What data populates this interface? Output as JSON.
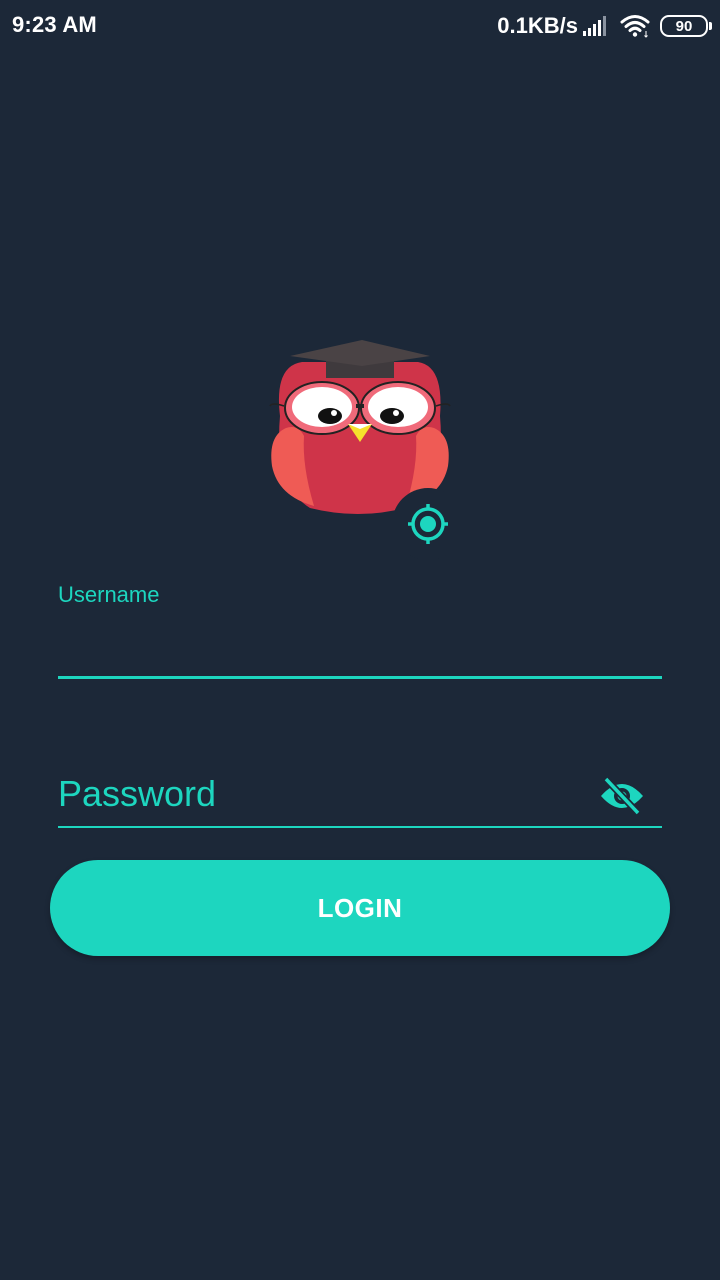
{
  "status_bar": {
    "time": "9:23 AM",
    "network_speed": "0.1KB/s",
    "battery_level": "90",
    "icons": [
      "signal-icon",
      "wifi-icon",
      "battery-icon"
    ]
  },
  "logo": {
    "icon": "owl-graduate-logo",
    "locate_icon": "crosshair-target-icon"
  },
  "form": {
    "username": {
      "label": "Username",
      "value": ""
    },
    "password": {
      "placeholder": "Password",
      "value": "",
      "toggle_icon": "eye-off-icon"
    },
    "login_label": "LOGIN"
  },
  "colors": {
    "background": "#1c2838",
    "accent": "#1dd6bf",
    "text": "#ffffff"
  }
}
